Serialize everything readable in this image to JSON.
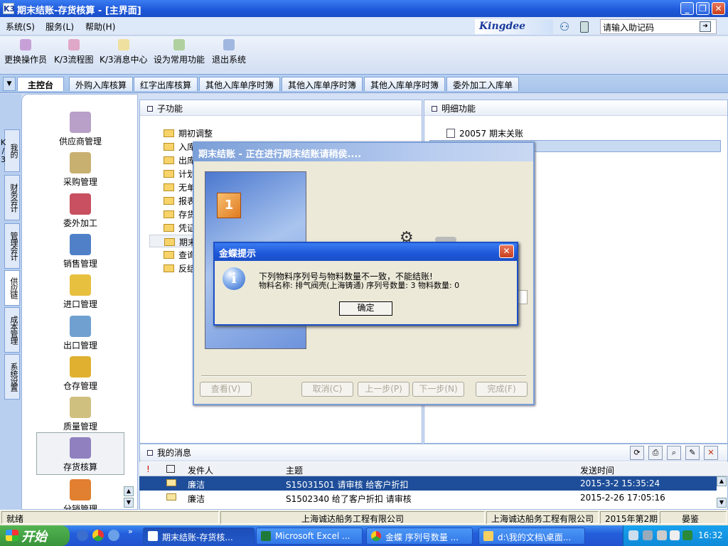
{
  "window": {
    "title": "期末结账-存货核算 - [主界面]",
    "app_icon": "K3"
  },
  "menubar": {
    "items": [
      "系统(S)",
      "服务(L)",
      "帮助(H)"
    ]
  },
  "brand": {
    "logo": "Kingdee",
    "quick_search_value": "请输入助记码"
  },
  "toolbar": {
    "items": [
      "更换操作员",
      "K/3流程图",
      "K/3消息中心",
      "设为常用功能",
      "退出系统"
    ]
  },
  "tabs": {
    "items": [
      "主控台",
      "外购入库核算",
      "红字出库核算",
      "其他入库单序时簿",
      "其他入库单序时簿",
      "其他入库单序时簿",
      "委外加工入库单"
    ],
    "active": 0
  },
  "left_tabs": {
    "items": [
      "我的K/3",
      "财务会计",
      "管理会计",
      "供应链",
      "成本管理",
      "系统设置"
    ],
    "active": 3
  },
  "modules": {
    "items": [
      "供应商管理",
      "采购管理",
      "委外加工",
      "销售管理",
      "进口管理",
      "出口管理",
      "仓存管理",
      "质量管理",
      "存货核算",
      "分销管理"
    ],
    "active": 8
  },
  "subfunctions": {
    "title": "子功能",
    "items": [
      "期初调整",
      "入库核算",
      "出库核算",
      "计划价核算",
      "无单价单据维护",
      "报表分析",
      "存货跌价准备",
      "凭证管理",
      "期末处理",
      "查询",
      "反结账"
    ]
  },
  "details": {
    "title": "明细功能",
    "items": [
      "20057  期末关账"
    ]
  },
  "wizard": {
    "title": "期末结账 - 正在进行期末结账请稍侯....",
    "step_badge": "1",
    "buttons": [
      "查看(V)",
      "取消(C)",
      "上一步(P)",
      "下一步(N)",
      "完成(F)"
    ]
  },
  "alert": {
    "title": "金蝶提示",
    "line1": "下列物料序列号与物料数量不一致，不能结账!",
    "line2": "物料名称:  排气阀壳(上海铸通)  序列号数量:  3  物料数量:  0",
    "ok_label": "确定"
  },
  "messages": {
    "title": "我的消息",
    "columns": [
      "!",
      "",
      "发件人",
      "主题",
      "发送时间"
    ],
    "rows": [
      {
        "sender": "廉洁",
        "subject": "S15031501 请审核 给客户折扣",
        "time": "2015-3-2 15:35:24"
      },
      {
        "sender": "廉洁",
        "subject": "S1502340 给了客户折扣 请审核",
        "time": "2015-2-26 17:05:16"
      }
    ],
    "selected_row": 0
  },
  "statusbar": {
    "status": "就绪",
    "company1": "上海诚达船务工程有限公司",
    "company2": "上海诚达船务工程有限公司",
    "period": "2015年第2期",
    "user": "晏鉴"
  },
  "taskbar": {
    "start_label": "开始",
    "tasks": [
      "期末结账-存货核...",
      "Microsoft Excel ...",
      "金蝶 序列号数量 ...",
      "d:\\我的文档\\桌面..."
    ],
    "active_task": 0,
    "clock": "16:32"
  },
  "colors": {
    "title_blue": "#1d57d8",
    "selected_row": "#1e4e9a",
    "start_green": "#3a943a",
    "tray_blue": "#0f8ad8"
  }
}
